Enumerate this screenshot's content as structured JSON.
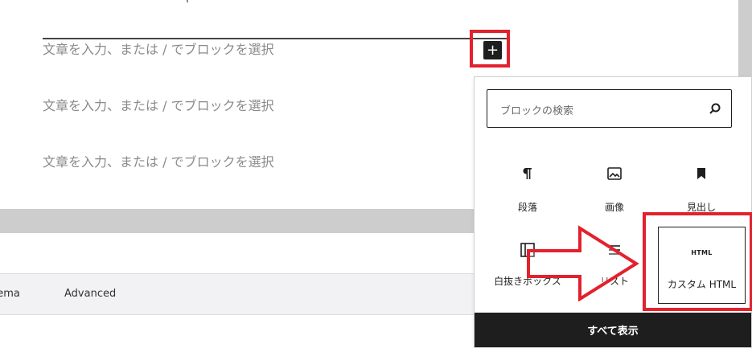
{
  "editor": {
    "paragraph_placeholders": [
      "文章を入力、または / でブロックを選択",
      "文章を入力、または / でブロックを選択",
      "文章を入力、または / でブロックを選択"
    ],
    "inserter_symbol": "+"
  },
  "meta_tabs": {
    "schema": "hema",
    "advanced": "Advanced"
  },
  "inserter": {
    "search_placeholder": "ブロックの検索",
    "blocks": {
      "paragraph": "段落",
      "image": "画像",
      "heading": "見出し",
      "group": "白抜きボックス",
      "list": "リスト",
      "custom_html_icon": "HTML",
      "custom_html": "カスタム HTML"
    },
    "browse_all": "すべて表示"
  },
  "colors": {
    "highlight": "#e3212d",
    "dark": "#1e1e1e",
    "placeholder_text": "#8a8a8a"
  }
}
